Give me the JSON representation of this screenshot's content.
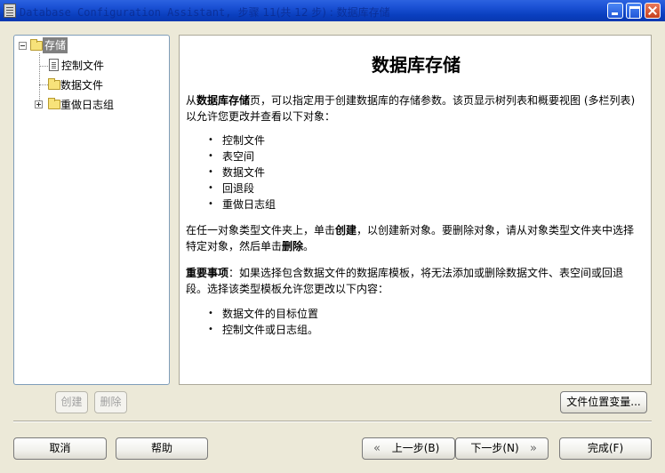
{
  "window": {
    "title_prefix": "Database Configuration Assistant, ",
    "title_step": "步骤 11(共 12 步) : 数据库存储"
  },
  "tree": {
    "root": "存储",
    "items": [
      "控制文件",
      "数据文件",
      "重做日志组"
    ]
  },
  "content": {
    "title": "数据库存储",
    "intro_pre": "从",
    "intro_bold": "数据库存储",
    "intro_post": "页，可以指定用于创建数据库的存储参数。该页显示树列表和概要视图 (多栏列表) 以允许您更改并查看以下对象：",
    "objects": [
      "控制文件",
      "表空间",
      "数据文件",
      "回退段",
      "重做日志组"
    ],
    "create_pre": "在任一对象类型文件夹上，单击",
    "create_bold": "创建",
    "create_mid": "，以创建新对象。要删除对象，请从对象类型文件夹中选择特定对象，然后单击",
    "delete_bold": "删除",
    "create_post": "。",
    "note_bold": "重要事项",
    "note_text": "：如果选择包含数据文件的数据库模板，将无法添加或删除数据文件、表空间或回退段。选择该类型模板允许您更改以下内容：",
    "changeable": [
      "数据文件的目标位置",
      "控制文件或日志组。"
    ]
  },
  "buttons": {
    "create": "创建",
    "delete": "删除",
    "file_location_vars": "文件位置变量...",
    "cancel": "取消",
    "help": "帮助",
    "back": "上一步(B)",
    "next": "下一步(N)",
    "finish": "完成(F)"
  }
}
